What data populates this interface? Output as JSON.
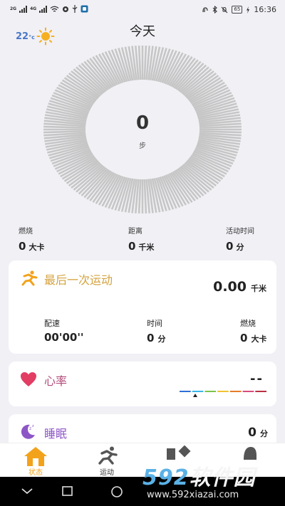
{
  "status_bar": {
    "left": [
      "2G",
      "4G"
    ],
    "battery": "65",
    "time": "16:36"
  },
  "header": {
    "title": "今天",
    "temperature": "22",
    "temp_unit": "°c"
  },
  "steps": {
    "value": "0",
    "unit": "步",
    "progress": 0
  },
  "stats": [
    {
      "label": "燃烧",
      "value": "0",
      "unit": "大卡"
    },
    {
      "label": "距离",
      "value": "0",
      "unit": "千米"
    },
    {
      "label": "活动时间",
      "value": "0",
      "unit": "分"
    }
  ],
  "last_workout": {
    "title": "最后一次运动",
    "distance": "0.00",
    "distance_unit": "千米",
    "pace_label": "配速",
    "pace_value": "00'00''",
    "time_label": "时间",
    "time_value": "0",
    "time_unit": "分",
    "burn_label": "燃烧",
    "burn_value": "0",
    "burn_unit": "大卡"
  },
  "heart_rate": {
    "title": "心率",
    "value": "--",
    "zone_colors": [
      "#2f6fd6",
      "#39b6e8",
      "#7cc34a",
      "#f1c232",
      "#e77a2a",
      "#d94b7a",
      "#b73144"
    ]
  },
  "sleep": {
    "title": "睡眠",
    "value": "0",
    "unit": "分"
  },
  "nav": {
    "items": [
      {
        "label": "状态",
        "icon": "home-icon",
        "active": true
      },
      {
        "label": "运动",
        "icon": "running-icon",
        "active": false
      },
      {
        "label": "",
        "icon": "device-icon",
        "active": false
      },
      {
        "label": "",
        "icon": "profile-icon",
        "active": false
      }
    ]
  },
  "watermark": {
    "brand_num": "592",
    "brand_text": "软件园",
    "url": "www.592xiazai.com"
  },
  "colors": {
    "accent_orange": "#f3a21c",
    "title_gold": "#d4a23e",
    "heart_red": "#e23d63",
    "heart_title": "#b24b79",
    "sleep_purple": "#8d56c7"
  }
}
